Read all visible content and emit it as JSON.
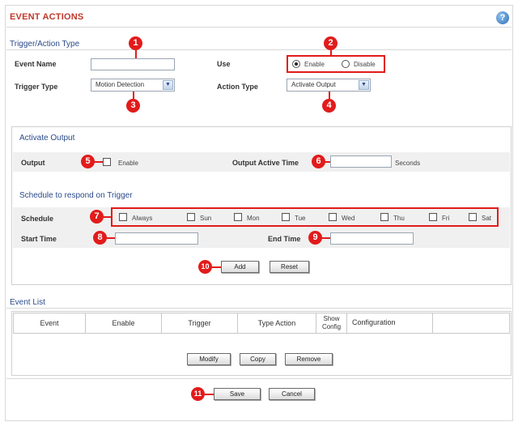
{
  "header": {
    "title": "EVENT ACTIONS",
    "help_icon": "?"
  },
  "trigger_action": {
    "section_title": "Trigger/Action Type",
    "event_name_label": "Event Name",
    "event_name_value": "",
    "use_label": "Use",
    "use_options": [
      "Enable",
      "Disable"
    ],
    "use_selected": "Enable",
    "trigger_type_label": "Trigger Type",
    "trigger_type_value": "Motion Detection",
    "action_type_label": "Action Type",
    "action_type_value": "Activate Output"
  },
  "activate_output": {
    "section_title": "Activate Output",
    "output_label": "Output",
    "output_enable_label": "Enable",
    "active_time_label": "Output Active Time",
    "active_time_value": "",
    "active_time_unit": "Seconds"
  },
  "schedule": {
    "section_title": "Schedule to respond on Trigger",
    "schedule_label": "Schedule",
    "days": [
      "Always",
      "Sun",
      "Mon",
      "Tue",
      "Wed",
      "Thu",
      "Fri",
      "Sat"
    ],
    "start_time_label": "Start Time",
    "end_time_label": "End Time",
    "add_label": "Add",
    "reset_label": "Reset"
  },
  "event_list": {
    "section_title": "Event List",
    "columns": [
      "Event",
      "Enable",
      "Trigger",
      "Type Action",
      "Show Config",
      "Configuration",
      ""
    ],
    "modify_label": "Modify",
    "copy_label": "Copy",
    "remove_label": "Remove"
  },
  "footer": {
    "save_label": "Save",
    "cancel_label": "Cancel"
  },
  "callouts": [
    "1",
    "2",
    "3",
    "4",
    "5",
    "6",
    "7",
    "8",
    "9",
    "10",
    "11"
  ],
  "colors": {
    "title_red": "#c0392b",
    "callout_red": "#e21b1b",
    "section_blue": "#2a4a8a"
  }
}
